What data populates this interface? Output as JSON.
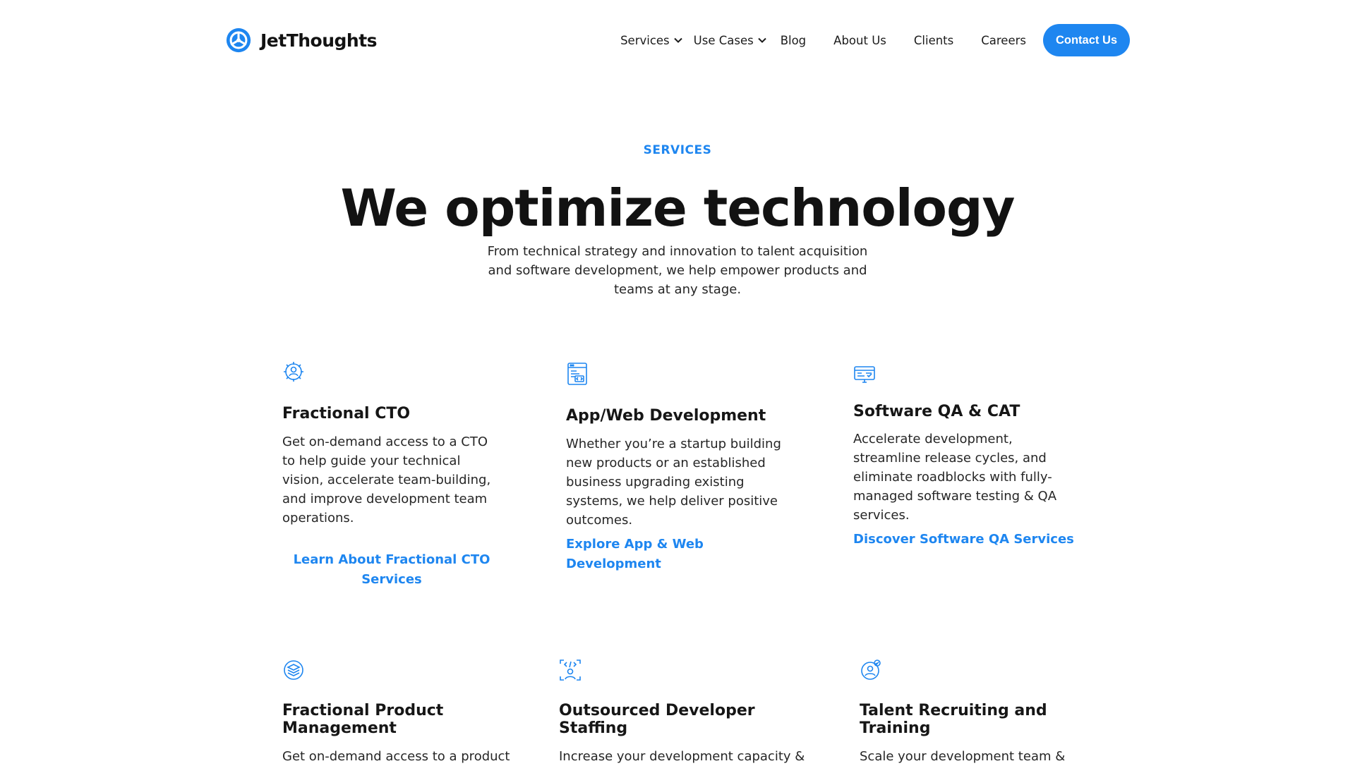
{
  "header": {
    "logo_text": "JetThoughts",
    "nav": {
      "services": "Services",
      "use_cases": "Use Cases",
      "blog": "Blog",
      "about": "About Us",
      "clients": "Clients",
      "careers": "Careers",
      "contact": "Contact Us"
    }
  },
  "hero": {
    "eyebrow": "SERVICES",
    "title": "We optimize technology",
    "subtitle": "From technical strategy and innovation to talent acquisition and software development, we help empower products and teams at any stage."
  },
  "services": [
    {
      "icon": "cto-gear-person-icon",
      "title": "Fractional CTO",
      "description": "Get on-demand access to a CTO to help guide your technical vision, accelerate team-building, and improve development team operations.",
      "link": "Learn About Fractional CTO Services"
    },
    {
      "icon": "web-window-code-icon",
      "title": "App/Web Development",
      "description": "Whether you’re a startup building new products or an established business upgrading existing systems, we help deliver positive outcomes.",
      "link": "Explore App & Web Development"
    },
    {
      "icon": "qa-screen-icon",
      "title": "Software QA & CAT",
      "description": "Accelerate development, streamline release cycles, and eliminate roadblocks with fully-managed software testing & QA services.",
      "link": "Discover Software QA Services"
    },
    {
      "icon": "product-layers-icon",
      "title": "Fractional Product Management",
      "description": "Get on-demand access to a product",
      "link": ""
    },
    {
      "icon": "developer-code-person-icon",
      "title": "Outsourced Developer Staffing",
      "description": "Increase your development capacity &",
      "link": ""
    },
    {
      "icon": "talent-person-target-icon",
      "title": "Talent Recruiting and Training",
      "description": "Scale your development team &",
      "link": ""
    }
  ],
  "colors": {
    "accent": "#1e86f0",
    "text": "#1b1b1b",
    "background": "#ffffff"
  }
}
